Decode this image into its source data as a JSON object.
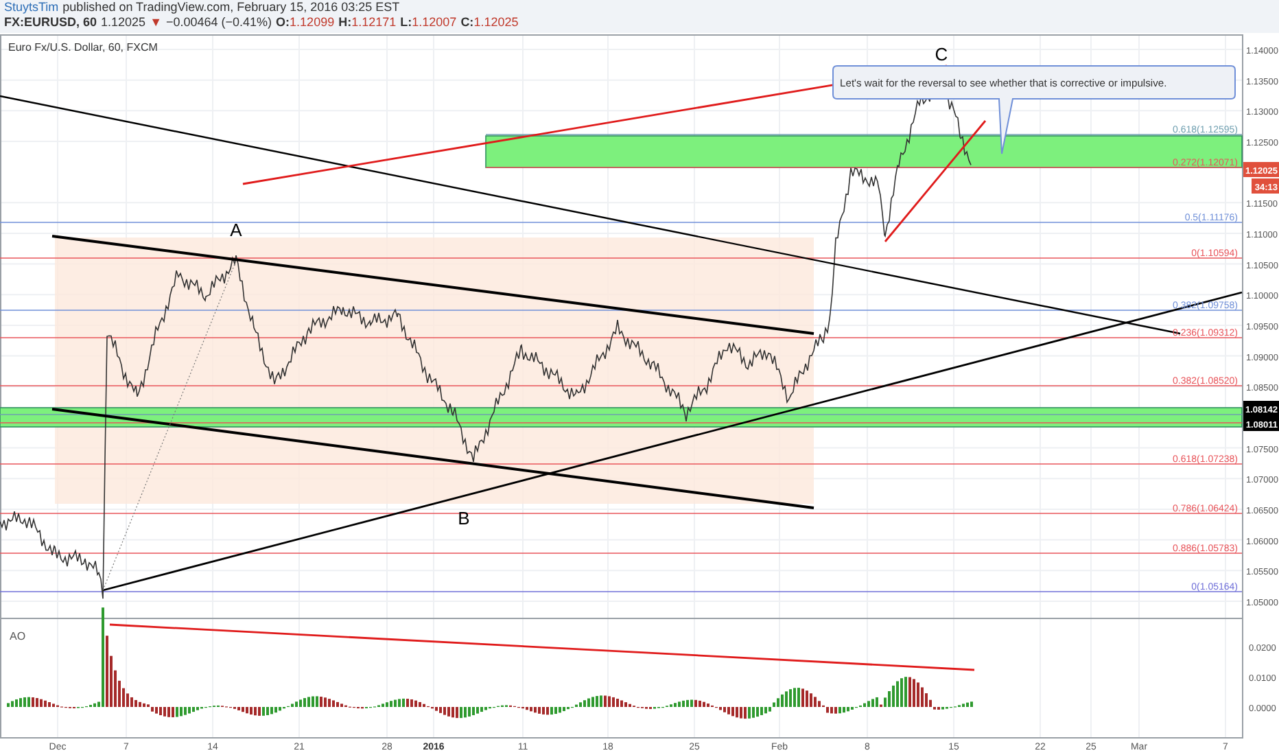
{
  "header": {
    "author": "StuytsTim",
    "published": "published on TradingView.com, February 15, 2016 03:25 EST",
    "symbol": "FX:EURUSD, 60",
    "last": "1.12025",
    "change_arrow": "▼",
    "change": "−0.00464 (−0.41%)",
    "ohlc": [
      {
        "label": "O:",
        "value": "1.12099"
      },
      {
        "label": "H:",
        "value": "1.12171"
      },
      {
        "label": "L:",
        "value": "1.12007"
      },
      {
        "label": "C:",
        "value": "1.12025"
      }
    ]
  },
  "chart": {
    "title": "Euro Fx/U.S. Dollar, 60, FXCM",
    "price_axis_labels": [
      "1.14000",
      "1.13500",
      "1.13000",
      "1.12500",
      "1.11500",
      "1.11000",
      "1.10500",
      "1.10000",
      "1.09500",
      "1.09000",
      "1.08500",
      "1.07500",
      "1.07000",
      "1.06500",
      "1.06000",
      "1.05500",
      "1.05000"
    ],
    "price_badges": [
      {
        "text": "1.12025",
        "color": "#e0503c"
      },
      {
        "text": "34:13",
        "color": "#e0503c"
      },
      {
        "text": "1.08142",
        "color": "#000000"
      },
      {
        "text": "1.08011",
        "color": "#000000"
      }
    ],
    "time_axis_labels": [
      "Dec",
      "7",
      "14",
      "21",
      "28",
      "2016",
      "11",
      "18",
      "25",
      "Feb",
      "8",
      "15",
      "22",
      "25",
      "Mar",
      "7"
    ],
    "fib_levels": [
      {
        "label": "0.618(1.12595)",
        "color": "#6f9fb0"
      },
      {
        "label": "0.272(1.12071)",
        "color": "#e8545a"
      },
      {
        "label": "0.5(1.11176)",
        "color": "#6f8fd8"
      },
      {
        "label": "0(1.10594)",
        "color": "#e8545a"
      },
      {
        "label": "0.382(1.09758)",
        "color": "#6f8fd8"
      },
      {
        "label": "0.236(1.09312)",
        "color": "#e8545a"
      },
      {
        "label": "0.382(1.08520)",
        "color": "#e8545a"
      },
      {
        "label": "0.618(1.07238)",
        "color": "#e8545a"
      },
      {
        "label": "0.786(1.06424)",
        "color": "#e8545a"
      },
      {
        "label": "0.886(1.05783)",
        "color": "#e8545a"
      },
      {
        "label": "0(1.05164)",
        "color": "#6f6fd8"
      }
    ],
    "wave_labels": [
      "A",
      "B",
      "C"
    ],
    "callout": "Let's wait for the reversal to see whether that is corrective or impulsive.",
    "indicator": {
      "name": "AO",
      "axis_labels": [
        "0.0200",
        "0.0100",
        "0.0000"
      ]
    }
  }
}
